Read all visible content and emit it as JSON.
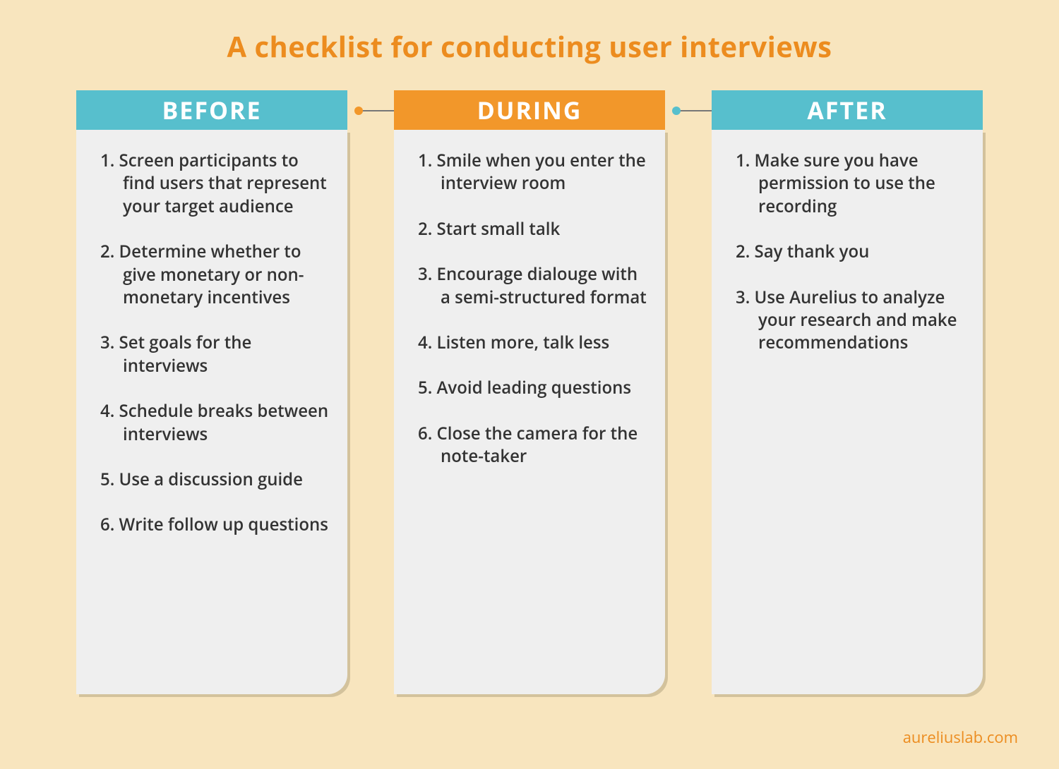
{
  "title": "A checklist for conducting user interviews",
  "footer": "aureliuslab.com",
  "columns": [
    {
      "key": "before",
      "heading": "BEFORE",
      "accent": "teal",
      "items": [
        "Screen participants to find users that represent your target audience",
        "Determine whether to give monetary or non-monetary incentives",
        "Set goals for the interviews",
        "Schedule breaks between interviews",
        "Use a discussion guide",
        "Write follow up questions"
      ]
    },
    {
      "key": "during",
      "heading": "DURING",
      "accent": "orange",
      "items": [
        "Smile when you enter the interview room",
        "Start small talk",
        "Encourage dialouge with a semi-structured format",
        "Listen more, talk less",
        "Avoid leading questions",
        "Close the camera for the note-taker"
      ]
    },
    {
      "key": "after",
      "heading": "AFTER",
      "accent": "teal",
      "items": [
        "Make sure you have permission to use the recording",
        "Say thank you",
        "Use Aurelius to analyze your research and make recommendations"
      ]
    }
  ]
}
